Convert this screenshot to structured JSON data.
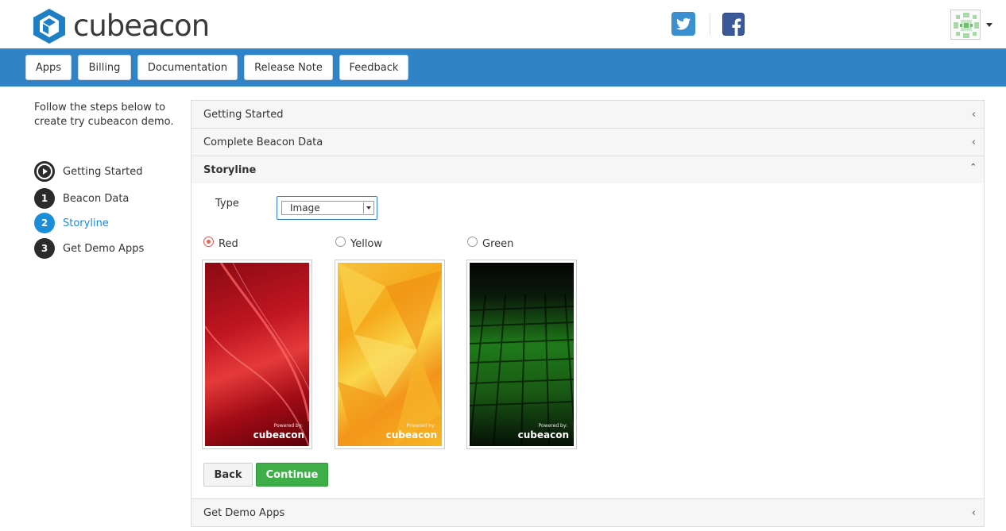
{
  "brand": {
    "name": "cubeacon"
  },
  "social": {
    "twitter_icon": "twitter-icon",
    "facebook_icon": "facebook-icon"
  },
  "nav": {
    "items": [
      {
        "label": "Apps"
      },
      {
        "label": "Billing"
      },
      {
        "label": "Documentation"
      },
      {
        "label": "Release Note"
      },
      {
        "label": "Feedback"
      }
    ]
  },
  "sidebar": {
    "intro": "Follow the steps below to create try cubeacon demo.",
    "steps": [
      {
        "marker": "",
        "label": "Getting Started",
        "icon": "play-icon"
      },
      {
        "marker": "1",
        "label": "Beacon Data"
      },
      {
        "marker": "2",
        "label": "Storyline",
        "active": true
      },
      {
        "marker": "3",
        "label": "Get Demo Apps"
      }
    ]
  },
  "accordion": {
    "sections": [
      {
        "title": "Getting Started",
        "expanded": false
      },
      {
        "title": "Complete Beacon Data",
        "expanded": false
      },
      {
        "title": "Storyline",
        "expanded": true
      },
      {
        "title": "Get Demo Apps",
        "expanded": false
      }
    ]
  },
  "storyline": {
    "type_label": "Type",
    "type_value": "Image",
    "options": [
      {
        "label": "Red",
        "checked": true,
        "watermark": "cubeacon",
        "powered": "Powered by:"
      },
      {
        "label": "Yellow",
        "checked": false,
        "watermark": "cubeacon",
        "powered": "Powered by:"
      },
      {
        "label": "Green",
        "checked": false,
        "watermark": "cubeacon",
        "powered": "Powered by:"
      }
    ],
    "back_label": "Back",
    "continue_label": "Continue"
  },
  "colors": {
    "nav_bg": "#3183c8",
    "accent": "#1a8cd8",
    "continue": "#3fae49"
  }
}
